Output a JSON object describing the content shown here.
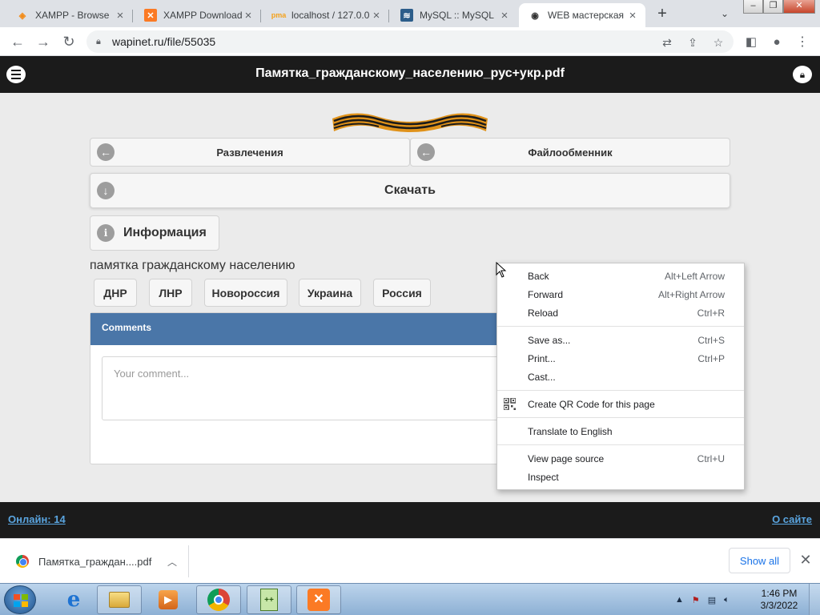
{
  "browser": {
    "tabs": [
      {
        "title": "XAMPP - Browse",
        "icon": "xampp-icon",
        "color": "#f28c1a"
      },
      {
        "title": "XAMPP Download",
        "icon": "xampp-icon",
        "color": "#fb7a24"
      },
      {
        "title": "localhost / 127.0.0",
        "icon": "phpmyadmin-icon",
        "color": "#f4a11a"
      },
      {
        "title": "MySQL :: MySQL",
        "icon": "mysql-icon",
        "color": "#2c5d8a"
      },
      {
        "title": "WEB мастерская",
        "icon": "wapinet-icon",
        "color": "#333333"
      }
    ],
    "url": "wapinet.ru/file/55035"
  },
  "page": {
    "title": "Памятка_гражданскому_населению_рус+укр.pdf",
    "nav_left": "Развлечения",
    "nav_right": "Файлообменник",
    "download": "Скачать",
    "info": "Информация",
    "description": "памятка гражданскому населению",
    "tags": [
      "ДНР",
      "ЛНР",
      "Новороссия",
      "Украина",
      "Россия"
    ],
    "comments_title": "Comments",
    "comment_placeholder": "Your comment...",
    "online": "Онлайн: 14",
    "about": "О сайте"
  },
  "context_menu": {
    "groups": [
      [
        {
          "label": "Back",
          "shortcut": "Alt+Left Arrow"
        },
        {
          "label": "Forward",
          "shortcut": "Alt+Right Arrow"
        },
        {
          "label": "Reload",
          "shortcut": "Ctrl+R"
        }
      ],
      [
        {
          "label": "Save as...",
          "shortcut": "Ctrl+S"
        },
        {
          "label": "Print...",
          "shortcut": "Ctrl+P"
        },
        {
          "label": "Cast...",
          "shortcut": ""
        }
      ],
      [
        {
          "label": "Create QR Code for this page",
          "shortcut": "",
          "icon": "qr-code-icon"
        }
      ],
      [
        {
          "label": "Translate to English",
          "shortcut": ""
        }
      ],
      [
        {
          "label": "View page source",
          "shortcut": "Ctrl+U"
        },
        {
          "label": "Inspect",
          "shortcut": ""
        }
      ]
    ]
  },
  "downloads": {
    "file": "Памятка_граждан....pdf",
    "show_all": "Show all"
  },
  "taskbar": {
    "time": "1:46 PM",
    "date": "3/3/2022"
  }
}
